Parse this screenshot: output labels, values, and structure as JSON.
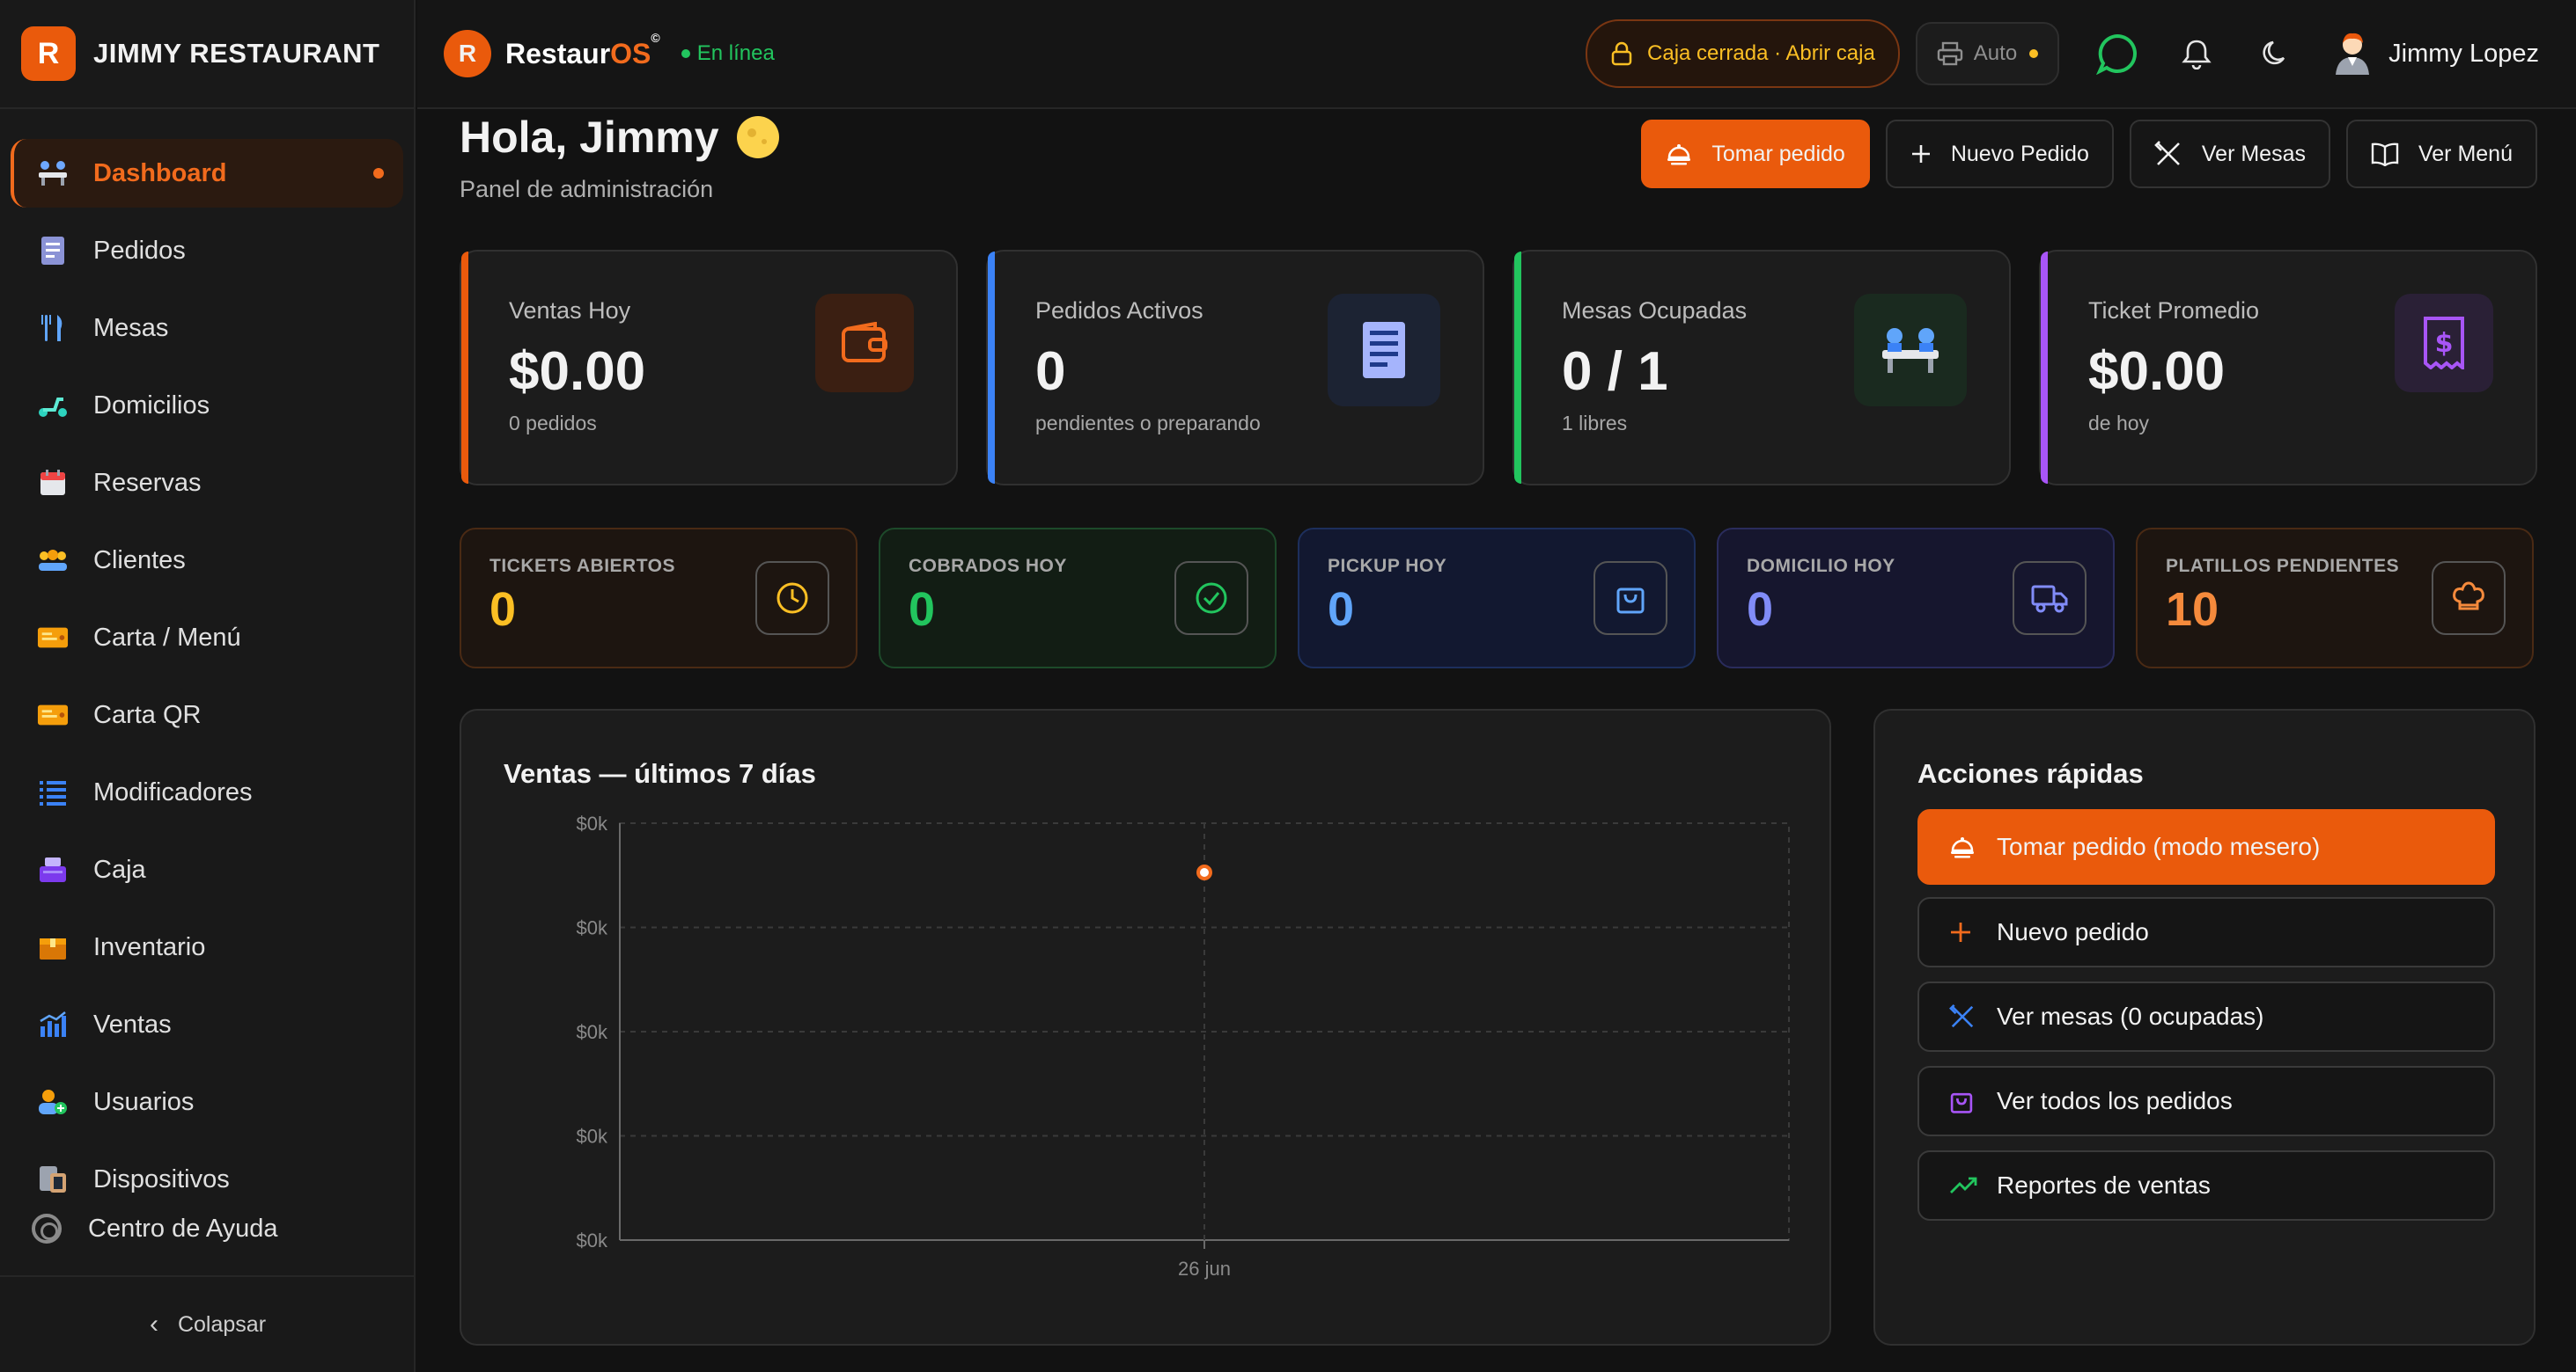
{
  "sidebar": {
    "brand_initial": "R",
    "brand_name": "JIMMY RESTAURANT",
    "items": [
      {
        "label": "Dashboard",
        "icon": "people-table-icon"
      },
      {
        "label": "Pedidos",
        "icon": "receipt-icon"
      },
      {
        "label": "Mesas",
        "icon": "fork-knife-icon"
      },
      {
        "label": "Domicilios",
        "icon": "scooter-icon"
      },
      {
        "label": "Reservas",
        "icon": "calendar-icon"
      },
      {
        "label": "Clientes",
        "icon": "people-icon"
      },
      {
        "label": "Carta / Menú",
        "icon": "ticket-icon"
      },
      {
        "label": "Carta QR",
        "icon": "ticket-icon"
      },
      {
        "label": "Modificadores",
        "icon": "list-icon"
      },
      {
        "label": "Caja",
        "icon": "cash-register-icon"
      },
      {
        "label": "Inventario",
        "icon": "box-icon"
      },
      {
        "label": "Ventas",
        "icon": "bar-chart-icon"
      },
      {
        "label": "Usuarios",
        "icon": "user-add-icon"
      },
      {
        "label": "Dispositivos",
        "icon": "devices-icon"
      }
    ],
    "help_label": "Centro de Ayuda",
    "collapse_label": "Colapsar"
  },
  "topbar": {
    "app_initial": "R",
    "app_name_main": "Restaur",
    "app_name_accent": "OS",
    "app_name_mark": "©",
    "status": "En línea",
    "caja_label": "Caja cerrada · Abrir caja",
    "printer_label": "Auto",
    "user_name": "Jimmy Lopez"
  },
  "header": {
    "greeting": "Hola, Jimmy",
    "subtitle": "Panel de administración",
    "actions": [
      "Tomar pedido",
      "Nuevo Pedido",
      "Ver Mesas",
      "Ver Menú"
    ]
  },
  "stats": [
    {
      "label": "Ventas Hoy",
      "value": "$0.00",
      "sub": "0 pedidos",
      "color": "#ea5a0c"
    },
    {
      "label": "Pedidos Activos",
      "value": "0",
      "sub": "pendientes o preparando",
      "color": "#3b82f6"
    },
    {
      "label": "Mesas Ocupadas",
      "value": "0 / 1",
      "sub": "1 libres",
      "color": "#22c55e"
    },
    {
      "label": "Ticket Promedio",
      "value": "$0.00",
      "sub": "de hoy",
      "color": "#a855f7"
    }
  ],
  "mini_stats": [
    {
      "label": "TICKETS ABIERTOS",
      "value": "0",
      "color": "#fbbf24"
    },
    {
      "label": "COBRADOS HOY",
      "value": "0",
      "color": "#22c55e"
    },
    {
      "label": "PICKUP HOY",
      "value": "0",
      "color": "#60a5fa"
    },
    {
      "label": "DOMICILIO HOY",
      "value": "0",
      "color": "#818cf8"
    },
    {
      "label": "PLATILLOS PENDIENTES",
      "value": "10",
      "color": "#f58a3c"
    }
  ],
  "chart": {
    "title": "Ventas — últimos 7 días"
  },
  "chart_data": {
    "type": "line",
    "title": "Ventas — últimos 7 días",
    "x": [
      "26 jun"
    ],
    "series": [
      {
        "values": [
          0
        ]
      }
    ],
    "y_tick_labels": [
      "$0k",
      "$0k",
      "$0k",
      "$0k",
      "$0k"
    ],
    "grid": true,
    "xlabel": "",
    "ylabel": ""
  },
  "quick_actions": {
    "title": "Acciones rápidas",
    "items": [
      {
        "label": "Tomar pedido (modo mesero)",
        "icon": "waiter-icon"
      },
      {
        "label": "Nuevo pedido",
        "icon": "plus-icon"
      },
      {
        "label": "Ver mesas (0 ocupadas)",
        "icon": "utensils-crossed-icon"
      },
      {
        "label": "Ver todos los pedidos",
        "icon": "shopping-bag-icon"
      },
      {
        "label": "Reportes de ventas",
        "icon": "trending-up-icon"
      }
    ]
  }
}
